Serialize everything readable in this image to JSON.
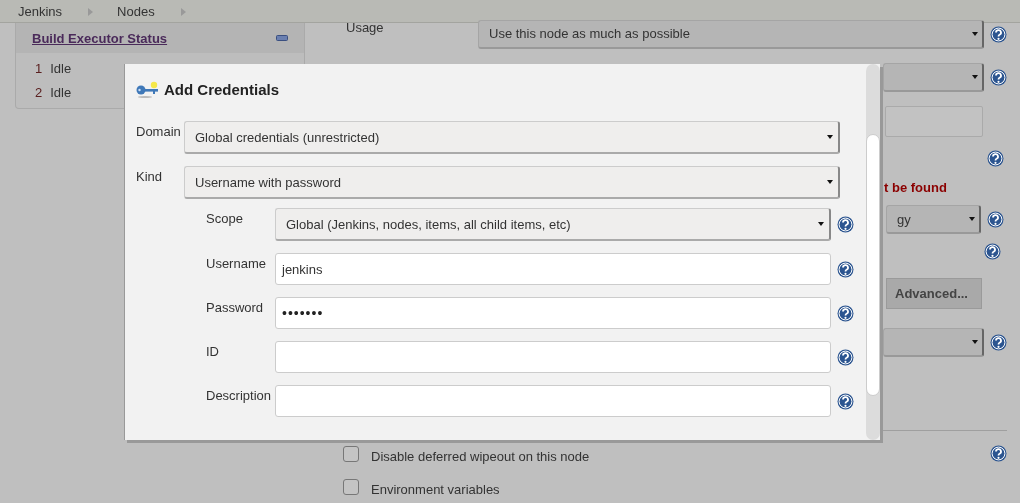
{
  "breadcrumbs": [
    {
      "label": "Jenkins"
    },
    {
      "label": "Nodes"
    }
  ],
  "sidebar": {
    "title": "Build Executor Status",
    "executors": [
      {
        "number": "1",
        "status": "Idle"
      },
      {
        "number": "2",
        "status": "Idle"
      }
    ]
  },
  "background_form": {
    "rows": [
      {
        "kind": "select",
        "label": "Usage",
        "value": "Use this node as much as possible",
        "help": true
      },
      {
        "kind": "select",
        "help": true
      },
      {
        "kind": "text",
        "help": false
      },
      {
        "kind": "help",
        "help": true
      },
      {
        "kind": "error",
        "text": "t be found",
        "help": false
      },
      {
        "kind": "select",
        "value": "gy",
        "help": true
      },
      {
        "kind": "help",
        "help": true
      },
      {
        "kind": "button",
        "text": "Advanced...",
        "help": false
      },
      {
        "kind": "select",
        "help": true
      }
    ],
    "checkboxes": [
      {
        "label": "Disable deferred wipeout on this node",
        "checked": false,
        "help": true
      },
      {
        "label": "Environment variables",
        "checked": false,
        "help": false
      }
    ]
  },
  "dialog": {
    "title": "Add Credentials",
    "fields": [
      {
        "label": "Domain",
        "kind": "select",
        "value": "Global credentials (unrestricted)",
        "help": false
      },
      {
        "label": "Kind",
        "kind": "select",
        "value": "Username with password",
        "help": false,
        "children": [
          {
            "label": "Scope",
            "kind": "select",
            "value": "Global (Jenkins, nodes, items, all child items, etc)",
            "help": true
          },
          {
            "label": "Username",
            "kind": "text",
            "value": "jenkins",
            "help": true
          },
          {
            "label": "Password",
            "kind": "password",
            "value": "•••••••",
            "help": true
          },
          {
            "label": "ID",
            "kind": "text",
            "help": true
          },
          {
            "label": "Description",
            "kind": "text",
            "help": true
          }
        ]
      }
    ]
  }
}
